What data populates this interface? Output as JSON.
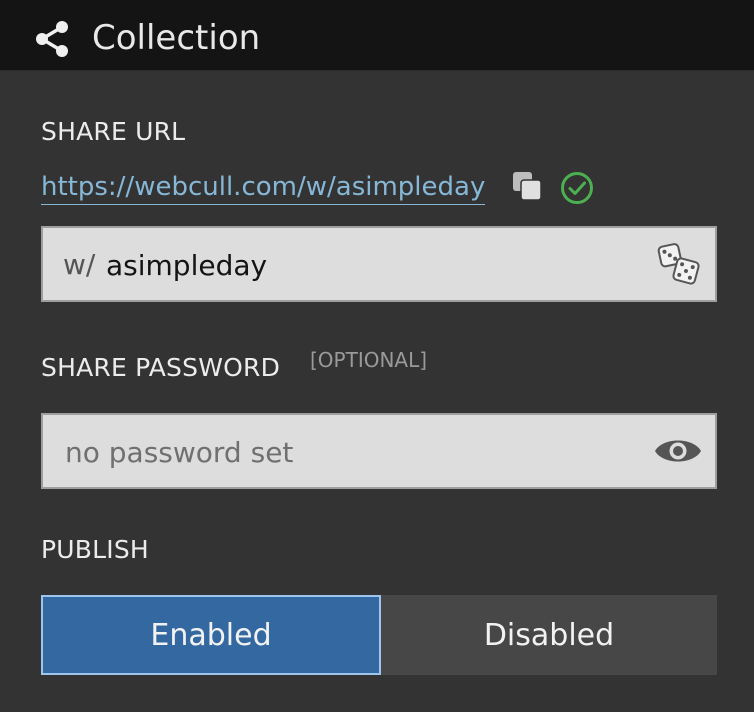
{
  "header": {
    "title": "Collection",
    "icon": "share-icon"
  },
  "share_url": {
    "label": "SHARE URL",
    "link": "https://webcull.com/w/asimpleday",
    "copy_icon": "copy-icon",
    "status_icon": "check-circle-icon",
    "status_color": "#4caf50",
    "prefix": "w/",
    "value": "asimpleday",
    "random_icon": "dice-icon"
  },
  "share_password": {
    "label": "SHARE PASSWORD",
    "optional": "[OPTIONAL]",
    "value": "",
    "placeholder": "no password set",
    "visibility_icon": "eye-icon"
  },
  "publish": {
    "label": "PUBLISH",
    "options": [
      "Enabled",
      "Disabled"
    ],
    "selected": "Enabled",
    "accent_color": "#3468a0"
  }
}
